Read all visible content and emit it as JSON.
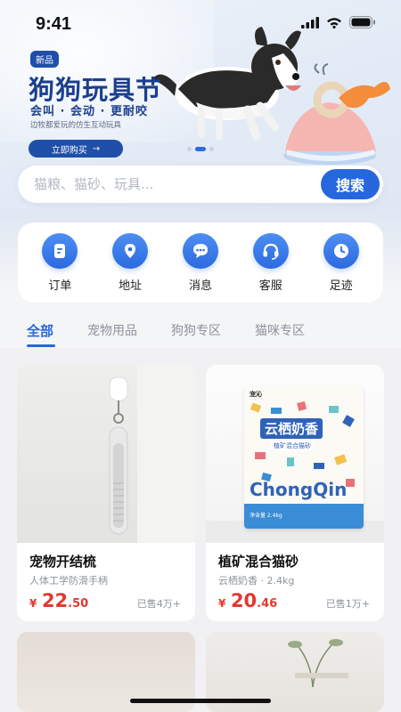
{
  "status_bar": {
    "time": "9:41"
  },
  "banner": {
    "badge": "新品",
    "title": "狗狗玩具节",
    "subtitle": "会叫 · 会动 · 更耐咬",
    "description": "边牧都爱玩的仿生互动玩具",
    "cta_label": "立即购买",
    "cta_arrow": "→"
  },
  "search": {
    "placeholder": "猫粮、猫砂、玩具...",
    "button_label": "搜索"
  },
  "quick_entries": [
    {
      "label": "订单",
      "icon": "order-icon"
    },
    {
      "label": "地址",
      "icon": "location-pin-icon"
    },
    {
      "label": "消息",
      "icon": "chat-bubble-icon"
    },
    {
      "label": "客服",
      "icon": "headset-icon"
    },
    {
      "label": "足迹",
      "icon": "clock-icon"
    }
  ],
  "tabs": [
    {
      "label": "全部",
      "active": true
    },
    {
      "label": "宠物用品",
      "active": false
    },
    {
      "label": "狗狗专区",
      "active": false
    },
    {
      "label": "猫咪专区",
      "active": false
    }
  ],
  "products": [
    {
      "name": "宠物开结梳",
      "meta": "人体工学防滑手柄",
      "currency": "¥",
      "price_int": "22",
      "price_dec": ".50",
      "sold": "已售4万+"
    },
    {
      "name": "植矿混合猫砂",
      "meta": "云栖奶香 · 2.4kg",
      "currency": "¥",
      "price_int": "20",
      "price_dec": ".46",
      "sold": "已售1万+",
      "package": {
        "brand_small": "宠沁",
        "title_cn": "云栖奶香",
        "tag": "植矿混合猫砂",
        "brand_en": "ChongQin",
        "weight": "净含量 2.4kg"
      }
    }
  ],
  "colors": {
    "accent": "#2767dd",
    "price": "#e2382f",
    "banner_title": "#1b3f8f"
  }
}
